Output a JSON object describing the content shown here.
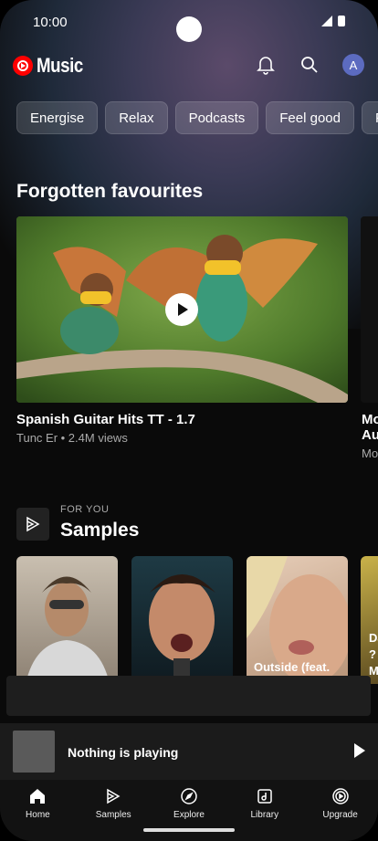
{
  "status": {
    "time": "10:00"
  },
  "app": {
    "name": "Music",
    "avatar_letter": "A",
    "brand_color": "#ff0000"
  },
  "chips": [
    "Energise",
    "Relax",
    "Podcasts",
    "Feel good",
    "Pa"
  ],
  "featured": {
    "section_title": "Forgotten favourites",
    "card": {
      "title": "Spanish Guitar Hits TT - 1.7",
      "subtitle": "Tunc Er • 2.4M views"
    },
    "peek_title": "Mo Au",
    "peek_sub": "Mo"
  },
  "samples": {
    "eyebrow": "FOR YOU",
    "title": "Samples",
    "thumbs": [
      {
        "label": ""
      },
      {
        "label": ""
      },
      {
        "label": "Outside (feat."
      }
    ],
    "peek_lines": [
      "Da",
      "?",
      "M"
    ]
  },
  "player": {
    "text": "Nothing is playing"
  },
  "nav": [
    {
      "label": "Home",
      "icon": "home-icon"
    },
    {
      "label": "Samples",
      "icon": "samples-icon"
    },
    {
      "label": "Explore",
      "icon": "compass-icon"
    },
    {
      "label": "Library",
      "icon": "library-icon"
    },
    {
      "label": "Upgrade",
      "icon": "upgrade-icon"
    }
  ]
}
